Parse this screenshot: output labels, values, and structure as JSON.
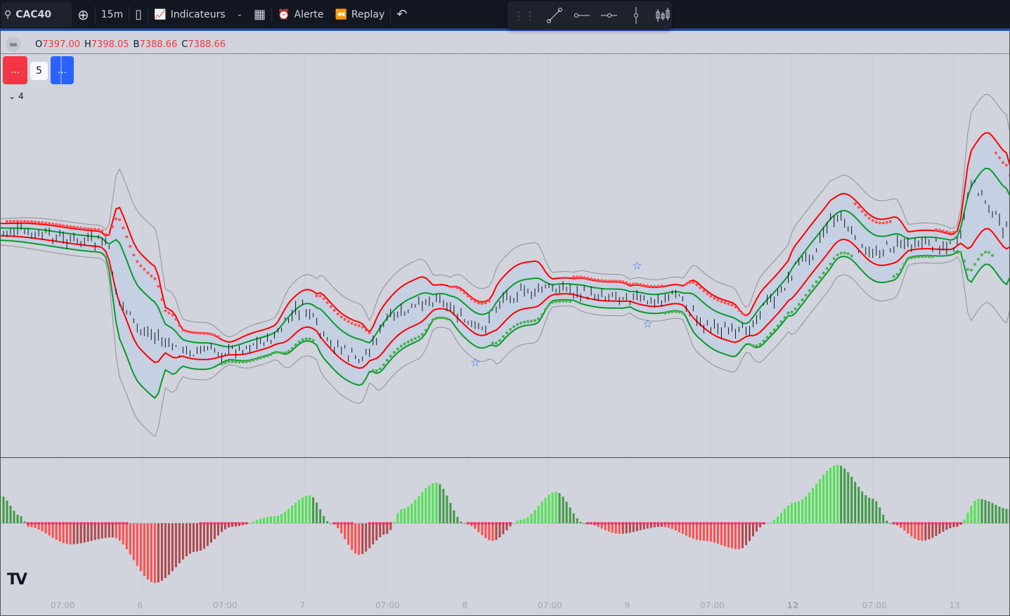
{
  "toolbar": {
    "symbol": "CAC40",
    "interval": "15m",
    "indicators": "Indicateurs",
    "alert": "Alerte",
    "replay": "Replay"
  },
  "legend": {
    "o_label": "O",
    "o": "7397.00",
    "h_label": "H",
    "h": "7398.05",
    "b_label": "B",
    "b": "7388.66",
    "c_label": "C",
    "c": "7388.66"
  },
  "buttons": {
    "sell": "...",
    "qty": "5",
    "buy": "...",
    "collapsed_count": "4"
  },
  "colors": {
    "up": "#089981",
    "down": "#f23645",
    "band_fill": "#c3cfe2",
    "upper": "#ff0000",
    "lower": "#089a2e"
  },
  "time_axis": [
    "07:00",
    "6",
    "07:00",
    "7",
    "07:00",
    "8",
    "07:00",
    "9",
    "07:00",
    "12",
    "07:00",
    "13"
  ],
  "chart_data": {
    "type": "line",
    "symbol": "CAC40",
    "price_keypoints": {
      "bar": [
        0,
        30,
        34,
        40,
        52,
        64,
        76,
        86,
        94,
        102,
        112,
        124,
        136,
        144,
        160,
        168,
        176,
        184,
        192,
        200,
        210,
        220,
        228,
        238,
        246,
        260,
        272,
        276,
        287
      ],
      "price": [
        7388,
        7380.5,
        7338,
        7318,
        7303,
        7303,
        7310.5,
        7333,
        7308,
        7298,
        7328,
        7340.5,
        7318,
        7343,
        7348,
        7343,
        7343,
        7338,
        7343,
        7323,
        7315.5,
        7340.5,
        7368,
        7398,
        7373,
        7380.5,
        7378,
        7420.5,
        7388
      ]
    },
    "oscillator_keypoints": {
      "bar": [
        0,
        6,
        8,
        20,
        32,
        44,
        56,
        66,
        78,
        88,
        94,
        102,
        110,
        114,
        124,
        132,
        140,
        148,
        158,
        166,
        176,
        188,
        200,
        210,
        218,
        226,
        238,
        248,
        253,
        262,
        272,
        278,
        287
      ],
      "value": [
        40,
        10,
        -5,
        -30,
        -20,
        -85,
        -40,
        -5,
        10,
        40,
        0,
        -45,
        -15,
        20,
        58,
        0,
        -25,
        5,
        45,
        0,
        -15,
        -5,
        -25,
        -37,
        0,
        30,
        83,
        35,
        0,
        -25,
        -5,
        35,
        20
      ]
    },
    "signals": [
      {
        "bar": 135,
        "type": "star"
      },
      {
        "bar": 181,
        "type": "star"
      },
      {
        "bar": 184,
        "type": "star"
      }
    ]
  }
}
